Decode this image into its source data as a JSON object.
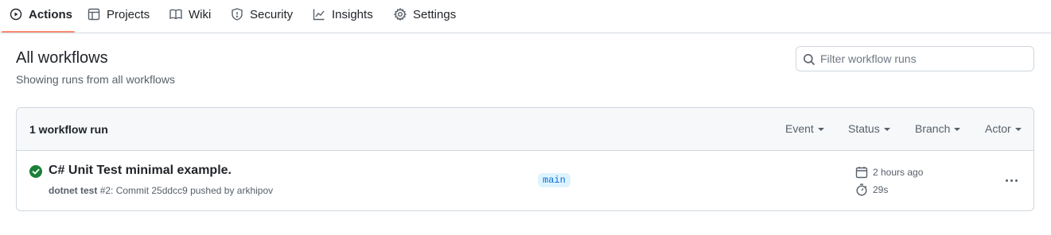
{
  "nav": {
    "tabs": [
      {
        "label": "Actions",
        "icon": "play-circle-icon",
        "active": true
      },
      {
        "label": "Projects",
        "icon": "table-icon"
      },
      {
        "label": "Wiki",
        "icon": "book-icon"
      },
      {
        "label": "Security",
        "icon": "shield-icon"
      },
      {
        "label": "Insights",
        "icon": "graph-icon"
      },
      {
        "label": "Settings",
        "icon": "gear-icon"
      }
    ]
  },
  "header": {
    "title": "All workflows",
    "subtitle": "Showing runs from all workflows"
  },
  "search": {
    "placeholder": "Filter workflow runs",
    "value": ""
  },
  "runs": {
    "count_label": "1 workflow run",
    "filters": [
      "Event",
      "Status",
      "Branch",
      "Actor"
    ],
    "items": [
      {
        "status": "success",
        "status_color": "#1a7f37",
        "title": "C# Unit Test minimal example.",
        "workflow": "dotnet test",
        "details": "#2: Commit 25ddcc9 pushed by arkhipov",
        "branch": "main",
        "time_ago": "2 hours ago",
        "duration": "29s"
      }
    ]
  },
  "colors": {
    "accent_underline": "#fd8c73",
    "success": "#1a7f37",
    "branch_bg": "#ddf4ff",
    "branch_text": "#0969da"
  }
}
